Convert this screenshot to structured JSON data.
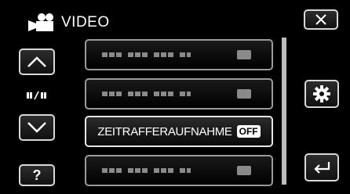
{
  "header": {
    "title": "VIDEO",
    "icon": "video-camera-icon"
  },
  "toolbar": {
    "close_icon": "close-icon",
    "up_icon": "chevron-up-icon",
    "down_icon": "chevron-down-icon",
    "help_label": "?",
    "settings_icon": "gear-icon",
    "back_icon": "back-arrow-icon"
  },
  "page_indicator": {
    "separator": "/"
  },
  "menu": {
    "items": [
      {
        "label": "",
        "state": "placeholder"
      },
      {
        "label": "",
        "state": "placeholder"
      },
      {
        "label": "ZEITRAFFERAUFNAHME",
        "value": "OFF"
      },
      {
        "label": "",
        "state": "placeholder"
      }
    ]
  },
  "colors": {
    "background": "#000000",
    "border": "#d8d8d8",
    "text": "#ffffff"
  }
}
